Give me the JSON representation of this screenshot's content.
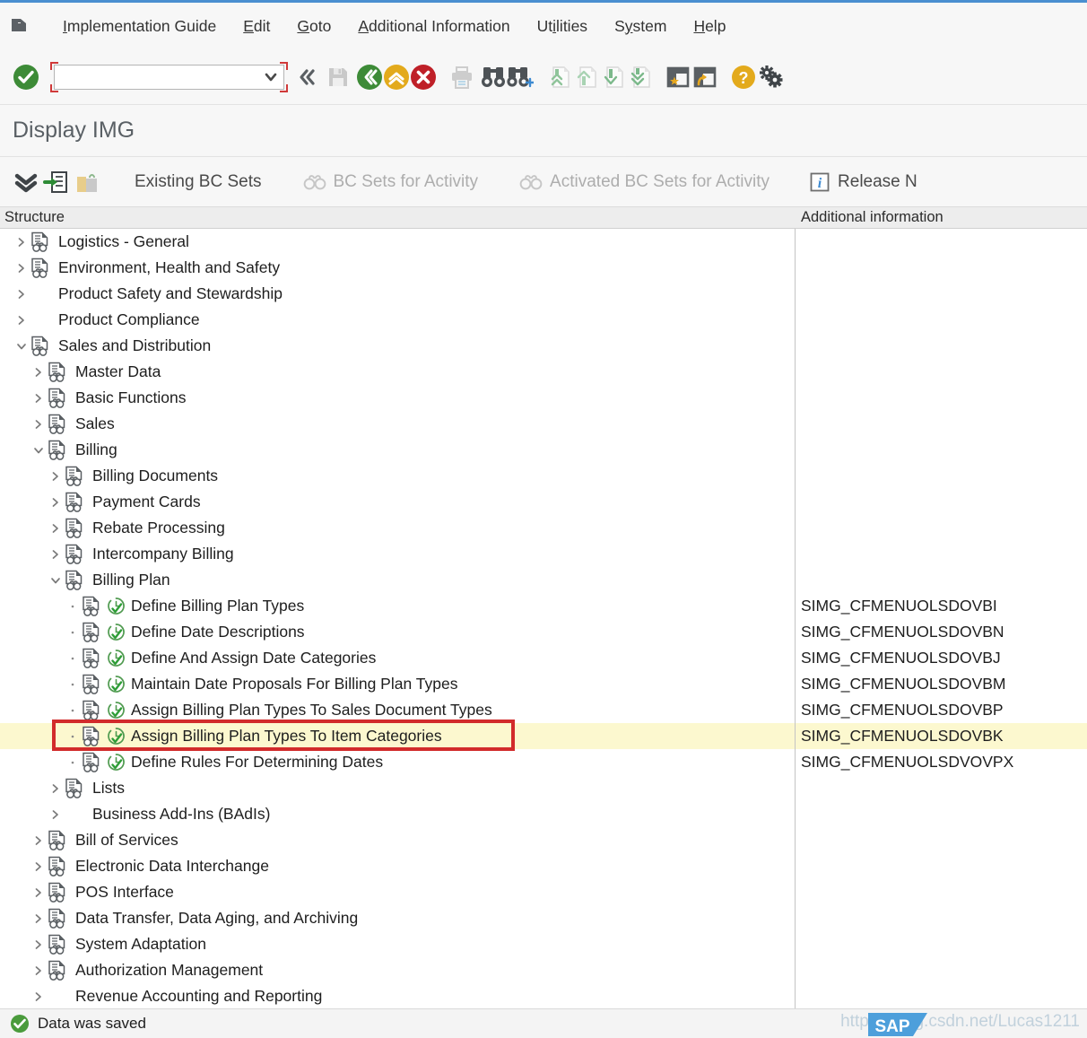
{
  "window": {
    "accent_color": "#4a8fd0",
    "title": "Display IMG"
  },
  "menu": {
    "system_icon": "sap-system-menu-icon",
    "items": [
      {
        "label": "Implementation Guide",
        "accel": "I"
      },
      {
        "label": "Edit",
        "accel": "E"
      },
      {
        "label": "Goto",
        "accel": "G"
      },
      {
        "label": "Additional Information",
        "accel": "A"
      },
      {
        "label": "Utilities",
        "accel": "i"
      },
      {
        "label": "System",
        "accel": "y"
      },
      {
        "label": "Help",
        "accel": "H"
      }
    ]
  },
  "toolbar": {
    "command_field": {
      "value": "",
      "placeholder": ""
    },
    "icons": [
      {
        "name": "enter-continue-icon",
        "title": "Continue (Enter)"
      },
      {
        "name": "collapse-command-field-icon",
        "title": "Hide command field"
      },
      {
        "name": "save-icon",
        "title": "Save"
      },
      {
        "name": "back-icon",
        "title": "Back"
      },
      {
        "name": "exit-icon",
        "title": "Exit"
      },
      {
        "name": "cancel-icon",
        "title": "Cancel"
      },
      {
        "name": "print-icon",
        "title": "Print"
      },
      {
        "name": "find-icon",
        "title": "Find"
      },
      {
        "name": "find-next-icon",
        "title": "Find Next"
      },
      {
        "name": "first-page-icon",
        "title": "First Page"
      },
      {
        "name": "previous-page-icon",
        "title": "Previous Page"
      },
      {
        "name": "next-page-icon",
        "title": "Next Page"
      },
      {
        "name": "last-page-icon",
        "title": "Last Page"
      },
      {
        "name": "create-favorite-icon",
        "title": "Create new session"
      },
      {
        "name": "create-shortcut-icon",
        "title": "Create shortcut"
      },
      {
        "name": "help-icon",
        "title": "Help"
      },
      {
        "name": "customize-local-layout-icon",
        "title": "Customizing of Local Layout"
      }
    ]
  },
  "app_toolbar": {
    "icons": [
      {
        "name": "expand-all-icon"
      },
      {
        "name": "goto-activity-icon"
      },
      {
        "name": "release-folder-icon"
      }
    ],
    "buttons": [
      {
        "label": "Existing BC Sets",
        "icon": "",
        "disabled": false
      },
      {
        "label": "BC Sets for Activity",
        "icon": "glasses-icon",
        "disabled": true
      },
      {
        "label": "Activated BC Sets for Activity",
        "icon": "glasses-icon",
        "disabled": true
      },
      {
        "label": "Release N",
        "icon": "info-icon",
        "disabled": false
      }
    ]
  },
  "columns": {
    "structure": "Structure",
    "additional_information": "Additional information"
  },
  "tree": {
    "rows": [
      {
        "label": "Logistics - General",
        "indent": 0,
        "twisty": "collapsed",
        "icon": "img-structure-icon",
        "exec": false,
        "addl": "",
        "highlight": false
      },
      {
        "label": "Environment, Health and Safety",
        "indent": 0,
        "twisty": "collapsed",
        "icon": "img-structure-icon",
        "exec": false,
        "addl": "",
        "highlight": false
      },
      {
        "label": "Product Safety and Stewardship",
        "indent": 0,
        "twisty": "collapsed",
        "icon": "none",
        "exec": false,
        "addl": "",
        "highlight": false
      },
      {
        "label": "Product Compliance",
        "indent": 0,
        "twisty": "collapsed",
        "icon": "none",
        "exec": false,
        "addl": "",
        "highlight": false
      },
      {
        "label": "Sales and Distribution",
        "indent": 0,
        "twisty": "expanded",
        "icon": "img-structure-icon",
        "exec": false,
        "addl": "",
        "highlight": false
      },
      {
        "label": "Master Data",
        "indent": 1,
        "twisty": "collapsed",
        "icon": "img-structure-icon",
        "exec": false,
        "addl": "",
        "highlight": false
      },
      {
        "label": "Basic Functions",
        "indent": 1,
        "twisty": "collapsed",
        "icon": "img-structure-icon",
        "exec": false,
        "addl": "",
        "highlight": false
      },
      {
        "label": "Sales",
        "indent": 1,
        "twisty": "collapsed",
        "icon": "img-structure-icon",
        "exec": false,
        "addl": "",
        "highlight": false
      },
      {
        "label": "Billing",
        "indent": 1,
        "twisty": "expanded",
        "icon": "img-structure-icon",
        "exec": false,
        "addl": "",
        "highlight": false
      },
      {
        "label": "Billing Documents",
        "indent": 2,
        "twisty": "collapsed",
        "icon": "img-structure-icon",
        "exec": false,
        "addl": "",
        "highlight": false
      },
      {
        "label": "Payment Cards",
        "indent": 2,
        "twisty": "collapsed",
        "icon": "img-structure-icon",
        "exec": false,
        "addl": "",
        "highlight": false
      },
      {
        "label": "Rebate Processing",
        "indent": 2,
        "twisty": "collapsed",
        "icon": "img-structure-icon",
        "exec": false,
        "addl": "",
        "highlight": false
      },
      {
        "label": "Intercompany Billing",
        "indent": 2,
        "twisty": "collapsed",
        "icon": "img-structure-icon",
        "exec": false,
        "addl": "",
        "highlight": false
      },
      {
        "label": "Billing Plan",
        "indent": 2,
        "twisty": "expanded",
        "icon": "img-structure-icon",
        "exec": false,
        "addl": "",
        "highlight": false
      },
      {
        "label": "Define Billing Plan Types",
        "indent": 3,
        "twisty": "leaf",
        "icon": "img-activity-icon",
        "exec": true,
        "addl": "SIMG_CFMENUOLSDOVBI",
        "highlight": false
      },
      {
        "label": "Define Date Descriptions",
        "indent": 3,
        "twisty": "leaf",
        "icon": "img-activity-icon",
        "exec": true,
        "addl": "SIMG_CFMENUOLSDOVBN",
        "highlight": false
      },
      {
        "label": "Define And Assign Date Categories",
        "indent": 3,
        "twisty": "leaf",
        "icon": "img-activity-icon",
        "exec": true,
        "addl": "SIMG_CFMENUOLSDOVBJ",
        "highlight": false
      },
      {
        "label": "Maintain Date Proposals For Billing Plan Types",
        "indent": 3,
        "twisty": "leaf",
        "icon": "img-activity-icon",
        "exec": true,
        "addl": "SIMG_CFMENUOLSDOVBM",
        "highlight": false
      },
      {
        "label": "Assign Billing Plan Types To Sales Document Types",
        "indent": 3,
        "twisty": "leaf",
        "icon": "img-activity-icon",
        "exec": true,
        "addl": "SIMG_CFMENUOLSDOVBP",
        "highlight": false
      },
      {
        "label": "Assign Billing Plan Types To Item Categories",
        "indent": 3,
        "twisty": "leaf",
        "icon": "img-activity-icon",
        "exec": true,
        "addl": "SIMG_CFMENUOLSDOVBK",
        "highlight": true
      },
      {
        "label": "Define Rules For Determining Dates",
        "indent": 3,
        "twisty": "leaf",
        "icon": "img-activity-icon",
        "exec": true,
        "addl": "SIMG_CFMENUOLSDVOVPX",
        "highlight": false
      },
      {
        "label": "Lists",
        "indent": 2,
        "twisty": "collapsed",
        "icon": "img-structure-icon",
        "exec": false,
        "addl": "",
        "highlight": false
      },
      {
        "label": "Business Add-Ins (BAdIs)",
        "indent": 2,
        "twisty": "collapsed",
        "icon": "none",
        "exec": false,
        "addl": "",
        "highlight": false
      },
      {
        "label": "Bill of Services",
        "indent": 1,
        "twisty": "collapsed",
        "icon": "img-structure-icon",
        "exec": false,
        "addl": "",
        "highlight": false
      },
      {
        "label": "Electronic Data Interchange",
        "indent": 1,
        "twisty": "collapsed",
        "icon": "img-structure-icon",
        "exec": false,
        "addl": "",
        "highlight": false
      },
      {
        "label": "POS Interface",
        "indent": 1,
        "twisty": "collapsed",
        "icon": "img-structure-icon",
        "exec": false,
        "addl": "",
        "highlight": false
      },
      {
        "label": "Data Transfer, Data Aging, and Archiving",
        "indent": 1,
        "twisty": "collapsed",
        "icon": "img-structure-icon",
        "exec": false,
        "addl": "",
        "highlight": false
      },
      {
        "label": "System Adaptation",
        "indent": 1,
        "twisty": "collapsed",
        "icon": "img-structure-icon",
        "exec": false,
        "addl": "",
        "highlight": false
      },
      {
        "label": "Authorization Management",
        "indent": 1,
        "twisty": "collapsed",
        "icon": "img-structure-icon",
        "exec": false,
        "addl": "",
        "highlight": false
      },
      {
        "label": "Revenue Accounting and Reporting",
        "indent": 1,
        "twisty": "collapsed",
        "icon": "none",
        "exec": false,
        "addl": "",
        "highlight": false
      }
    ]
  },
  "annotation": {
    "color": "#d22b2b",
    "target_row_label": "Assign Billing Plan Types To Item Categories"
  },
  "status": {
    "icon": "success-icon",
    "message": "Data was saved",
    "logo": "sap-logo",
    "logo_text": "SAP",
    "watermark": "https://blog.csdn.net/Lucas1211"
  }
}
